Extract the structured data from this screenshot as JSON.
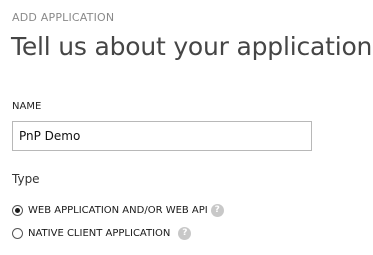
{
  "dialog": {
    "subtitle": "ADD APPLICATION",
    "title": "Tell us about your application"
  },
  "name_field": {
    "label": "NAME",
    "value": "PnP Demo"
  },
  "type_group": {
    "label": "Type",
    "options": [
      {
        "label": "WEB APPLICATION AND/OR WEB API",
        "selected": true,
        "help_icon": "question-mark"
      },
      {
        "label": "NATIVE CLIENT APPLICATION",
        "selected": false,
        "help_icon": "question-mark"
      }
    ]
  },
  "icons": {
    "help_glyph": "?"
  },
  "colors": {
    "subtitle": "#8a8a8a",
    "title": "#454545",
    "input_border": "#b8b8b8",
    "help_icon_bg": "#c8c8c8"
  }
}
